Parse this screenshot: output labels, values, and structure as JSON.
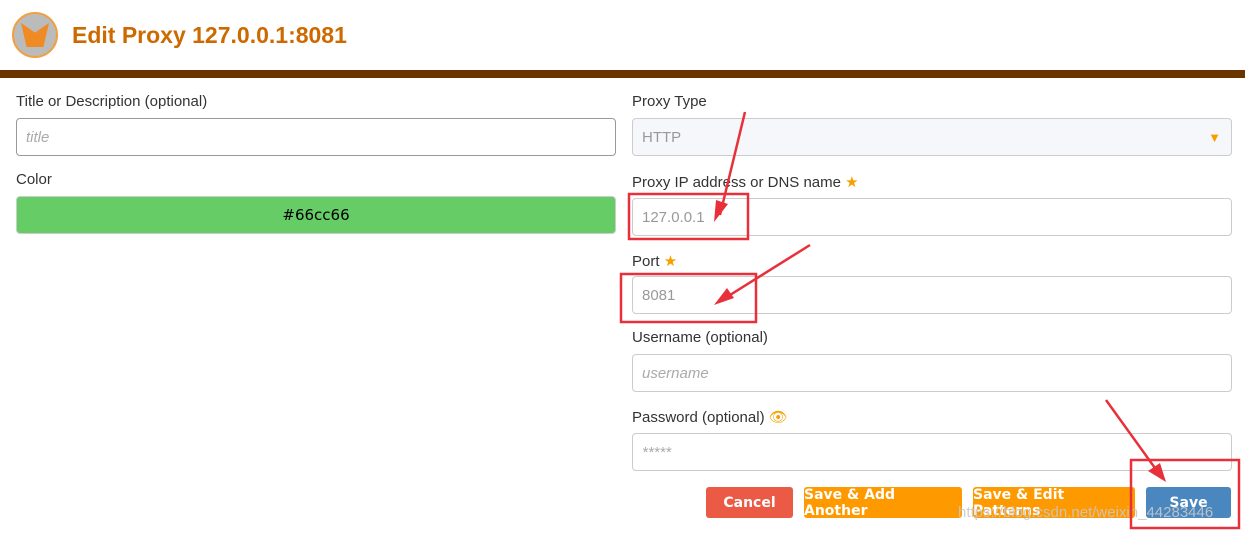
{
  "header": {
    "title": "Edit Proxy 127.0.0.1:8081"
  },
  "left": {
    "title_label": "Title or Description (optional)",
    "title_placeholder": "title",
    "color_label": "Color",
    "color_value": "#66cc66"
  },
  "right": {
    "proxy_type_label": "Proxy Type",
    "proxy_type_value": "HTTP",
    "ip_label": "Proxy IP address or DNS name",
    "ip_value": "127.0.0.1",
    "port_label": "Port",
    "port_value": "8081",
    "username_label": "Username (optional)",
    "username_placeholder": "username",
    "password_label": "Password (optional)",
    "password_placeholder": "*****"
  },
  "buttons": {
    "cancel": "Cancel",
    "save_add": "Save & Add Another",
    "save_edit": "Save & Edit Patterns",
    "save": "Save"
  },
  "colors": {
    "accent": "#cc6a00",
    "bar": "#6b3500",
    "cancel": "#ea5a45",
    "orange": "#ff9900",
    "save": "#4a87bf",
    "annotation": "#e8303a"
  },
  "watermark": "https://blog.csdn.net/weixin_44283446"
}
